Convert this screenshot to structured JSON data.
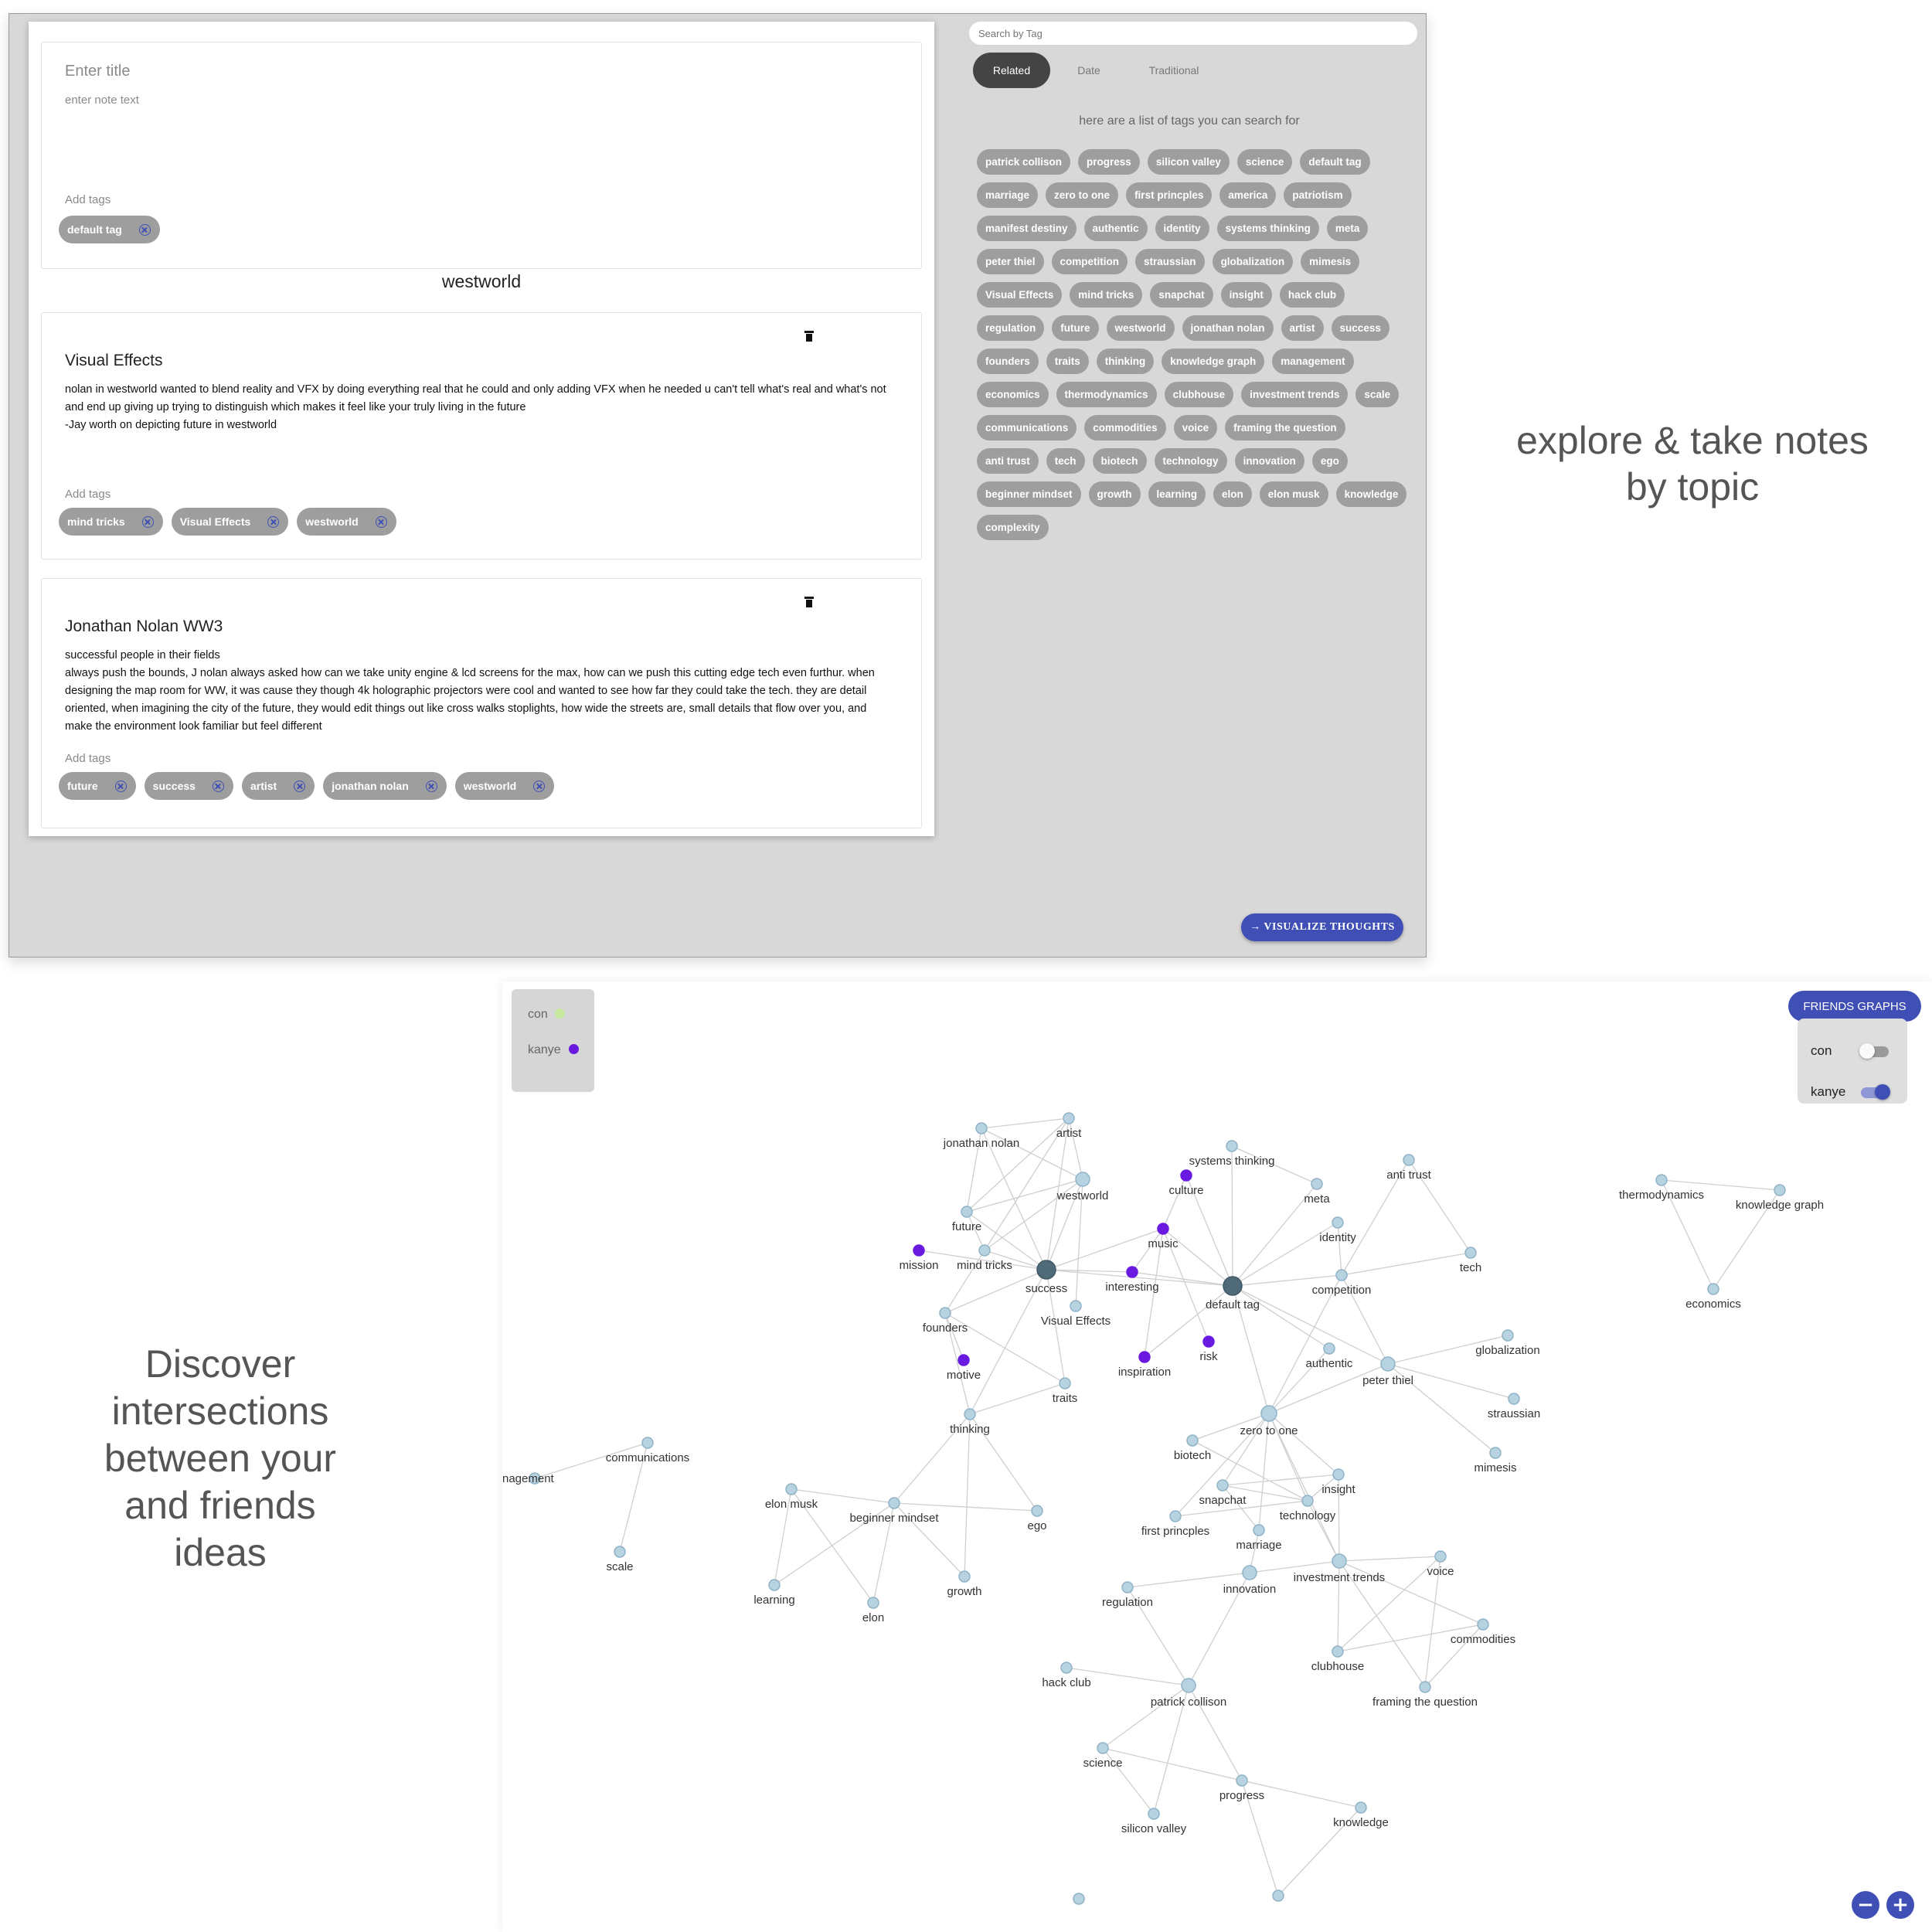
{
  "top": {
    "new_note": {
      "title_placeholder": "Enter title",
      "text_placeholder": "enter note text",
      "add_tags": "Add tags",
      "tags": [
        "default tag"
      ]
    },
    "group_heading": "westworld",
    "notes": [
      {
        "title": "Visual Effects",
        "body": "nolan in westworld wanted to blend reality and VFX by doing everything real that he could and only adding VFX when he needed u can't tell what's real and what's not and end up giving up trying to distinguish which makes it feel like your truly living in the future\n-Jay worth on depicting future in westworld",
        "add_tags": "Add tags",
        "tags": [
          "mind tricks",
          "Visual Effects",
          "westworld"
        ]
      },
      {
        "title": "Jonathan Nolan WW3",
        "body": "successful people in their fields\nalways push the bounds, J nolan always asked how can we take unity engine & lcd screens for the max, how can we push this cutting edge tech even furthur. when designing the map room for WW, it was cause they though 4k holographic projectors were cool and wanted to see how far they could take the tech. they are detail oriented, when imagining the city of the future, they would edit things out like cross walks stoplights, how wide the streets are, small details that flow over you, and make the environment look familiar but feel different",
        "add_tags": "Add tags",
        "tags": [
          "future",
          "success",
          "artist",
          "jonathan nolan",
          "westworld"
        ]
      }
    ],
    "search_placeholder": "Search by Tag",
    "tabs": [
      {
        "label": "Related",
        "active": true
      },
      {
        "label": "Date",
        "active": false
      },
      {
        "label": "Traditional",
        "active": false
      }
    ],
    "hint": "here are a list of tags you can search for",
    "tag_cloud": [
      "patrick collison",
      "progress",
      "silicon valley",
      "science",
      "default tag",
      "marriage",
      "zero to one",
      "first princples",
      "america",
      "patriotism",
      "manifest destiny",
      "authentic",
      "identity",
      "systems thinking",
      "meta",
      "peter thiel",
      "competition",
      "straussian",
      "globalization",
      "mimesis",
      "Visual Effects",
      "mind tricks",
      "snapchat",
      "insight",
      "hack club",
      "regulation",
      "future",
      "westworld",
      "jonathan nolan",
      "artist",
      "success",
      "founders",
      "traits",
      "thinking",
      "knowledge graph",
      "management",
      "economics",
      "thermodynamics",
      "clubhouse",
      "investment trends",
      "scale",
      "communications",
      "commodities",
      "voice",
      "framing the question",
      "anti trust",
      "tech",
      "biotech",
      "technology",
      "innovation",
      "ego",
      "beginner mindset",
      "growth",
      "learning",
      "elon",
      "elon musk",
      "knowledge",
      "complexity"
    ],
    "visualize_button": "→ VISUALIZE THOUGHTS"
  },
  "captions": {
    "top": "explore & take notes by topic",
    "bottom": "Discover intersections between your and friends ideas"
  },
  "graph": {
    "legend": [
      {
        "name": "con",
        "color": "#c7e9a0"
      },
      {
        "name": "kanye",
        "color": "#6a1ae0"
      }
    ],
    "friends_button": "FRIENDS GRAPHS",
    "friends": [
      {
        "name": "con",
        "enabled": false
      },
      {
        "name": "kanye",
        "enabled": true
      }
    ],
    "colors": {
      "node": "#b7d2e0",
      "node_stroke": "#8fb3c7",
      "hub": "#4f6b7a",
      "friend": "#6a1ae0",
      "edge": "#cfcfcf",
      "accent": "#3f4fb5"
    },
    "zoom": {
      "minus": "−",
      "plus": "+"
    },
    "nodes": [
      {
        "id": "jonathan nolan",
        "label": "jonathan nolan"
      },
      {
        "id": "artist",
        "label": "artist"
      },
      {
        "id": "westworld",
        "label": "westworld"
      },
      {
        "id": "future",
        "label": "future"
      },
      {
        "id": "mind tricks",
        "label": "mind tricks"
      },
      {
        "id": "success",
        "label": "success",
        "hub": true
      },
      {
        "id": "mission",
        "label": "mission",
        "friend": true
      },
      {
        "id": "founders",
        "label": "founders"
      },
      {
        "id": "Visual Effects",
        "label": "Visual Effects"
      },
      {
        "id": "motive",
        "label": "motive",
        "friend": true
      },
      {
        "id": "traits",
        "label": "traits"
      },
      {
        "id": "thinking",
        "label": "thinking"
      },
      {
        "id": "culture",
        "label": "culture",
        "friend": true
      },
      {
        "id": "systems thinking",
        "label": "systems thinking"
      },
      {
        "id": "music",
        "label": "music",
        "friend": true
      },
      {
        "id": "interesting",
        "label": "interesting",
        "friend": true
      },
      {
        "id": "inspiration",
        "label": "inspiration",
        "friend": true
      },
      {
        "id": "risk",
        "label": "risk",
        "friend": true
      },
      {
        "id": "default tag",
        "label": "default tag",
        "hub": true
      },
      {
        "id": "meta",
        "label": "meta"
      },
      {
        "id": "anti trust",
        "label": "anti trust"
      },
      {
        "id": "identity",
        "label": "identity"
      },
      {
        "id": "tech",
        "label": "tech"
      },
      {
        "id": "competition",
        "label": "competition"
      },
      {
        "id": "authentic",
        "label": "authentic"
      },
      {
        "id": "peter thiel",
        "label": "peter thiel"
      },
      {
        "id": "globalization",
        "label": "globalization"
      },
      {
        "id": "straussian",
        "label": "straussian"
      },
      {
        "id": "mimesis",
        "label": "mimesis"
      },
      {
        "id": "zero to one",
        "label": "zero to one"
      },
      {
        "id": "biotech",
        "label": "biotech"
      },
      {
        "id": "insight",
        "label": "insight"
      },
      {
        "id": "snapchat",
        "label": "snapchat"
      },
      {
        "id": "technology",
        "label": "technology"
      },
      {
        "id": "first princples",
        "label": "first princples"
      },
      {
        "id": "marriage",
        "label": "marriage"
      },
      {
        "id": "innovation",
        "label": "innovation"
      },
      {
        "id": "investment trends",
        "label": "investment trends"
      },
      {
        "id": "voice",
        "label": "voice"
      },
      {
        "id": "commodities",
        "label": "commodities"
      },
      {
        "id": "clubhouse",
        "label": "clubhouse"
      },
      {
        "id": "framing the question",
        "label": "framing the question"
      },
      {
        "id": "regulation",
        "label": "regulation"
      },
      {
        "id": "hack club",
        "label": "hack club"
      },
      {
        "id": "patrick collison",
        "label": "patrick collison"
      },
      {
        "id": "science",
        "label": "science"
      },
      {
        "id": "progress",
        "label": "progress"
      },
      {
        "id": "silicon valley",
        "label": "silicon valley"
      },
      {
        "id": "knowledge",
        "label": "knowledge"
      },
      {
        "id": "elon musk",
        "label": "elon musk"
      },
      {
        "id": "beginner mindset",
        "label": "beginner mindset"
      },
      {
        "id": "ego",
        "label": "ego"
      },
      {
        "id": "learning",
        "label": "learning"
      },
      {
        "id": "elon",
        "label": "elon"
      },
      {
        "id": "growth",
        "label": "growth"
      },
      {
        "id": "communications",
        "label": "communications"
      },
      {
        "id": "management",
        "label": "nagement"
      },
      {
        "id": "scale",
        "label": "scale"
      },
      {
        "id": "thermodynamics",
        "label": "thermodynamics"
      },
      {
        "id": "knowledge graph",
        "label": "knowledge graph"
      },
      {
        "id": "economics",
        "label": "economics"
      },
      {
        "id": "unlabeled-1",
        "label": ""
      },
      {
        "id": "unlabeled-2",
        "label": ""
      }
    ],
    "edges": [
      [
        "jonathan nolan",
        "artist"
      ],
      [
        "jonathan nolan",
        "westworld"
      ],
      [
        "jonathan nolan",
        "success"
      ],
      [
        "jonathan nolan",
        "future"
      ],
      [
        "artist",
        "westworld"
      ],
      [
        "artist",
        "success"
      ],
      [
        "artist",
        "future"
      ],
      [
        "artist",
        "mind tricks"
      ],
      [
        "westworld",
        "future"
      ],
      [
        "westworld",
        "mind tricks"
      ],
      [
        "westworld",
        "Visual Effects"
      ],
      [
        "westworld",
        "success"
      ],
      [
        "future",
        "success"
      ],
      [
        "future",
        "mind tricks"
      ],
      [
        "mind tricks",
        "success"
      ],
      [
        "mind tricks",
        "founders"
      ],
      [
        "success",
        "founders"
      ],
      [
        "success",
        "traits"
      ],
      [
        "success",
        "thinking"
      ],
      [
        "success",
        "default tag"
      ],
      [
        "success",
        "mission"
      ],
      [
        "success",
        "interesting"
      ],
      [
        "success",
        "music"
      ],
      [
        "founders",
        "traits"
      ],
      [
        "founders",
        "thinking"
      ],
      [
        "founders",
        "motive"
      ],
      [
        "traits",
        "thinking"
      ],
      [
        "thinking",
        "beginner mindset"
      ],
      [
        "thinking",
        "growth"
      ],
      [
        "thinking",
        "ego"
      ],
      [
        "culture",
        "music"
      ],
      [
        "music",
        "interesting"
      ],
      [
        "music",
        "inspiration"
      ],
      [
        "music",
        "risk"
      ],
      [
        "music",
        "default tag"
      ],
      [
        "culture",
        "default tag"
      ],
      [
        "default tag",
        "systems thinking"
      ],
      [
        "default tag",
        "meta"
      ],
      [
        "default tag",
        "identity"
      ],
      [
        "default tag",
        "competition"
      ],
      [
        "default tag",
        "authentic"
      ],
      [
        "default tag",
        "peter thiel"
      ],
      [
        "default tag",
        "zero to one"
      ],
      [
        "default tag",
        "inspiration"
      ],
      [
        "default tag",
        "interesting"
      ],
      [
        "systems thinking",
        "meta"
      ],
      [
        "anti trust",
        "competition"
      ],
      [
        "anti trust",
        "tech"
      ],
      [
        "identity",
        "competition"
      ],
      [
        "competition",
        "tech"
      ],
      [
        "competition",
        "peter thiel"
      ],
      [
        "competition",
        "zero to one"
      ],
      [
        "authentic",
        "zero to one"
      ],
      [
        "peter thiel",
        "zero to one"
      ],
      [
        "peter thiel",
        "globalization"
      ],
      [
        "peter thiel",
        "straussian"
      ],
      [
        "peter thiel",
        "mimesis"
      ],
      [
        "zero to one",
        "biotech"
      ],
      [
        "zero to one",
        "insight"
      ],
      [
        "zero to one",
        "snapchat"
      ],
      [
        "zero to one",
        "technology"
      ],
      [
        "zero to one",
        "first princples"
      ],
      [
        "zero to one",
        "investment trends"
      ],
      [
        "zero to one",
        "marriage"
      ],
      [
        "biotech",
        "technology"
      ],
      [
        "snapchat",
        "technology"
      ],
      [
        "snapchat",
        "insight"
      ],
      [
        "technology",
        "insight"
      ],
      [
        "technology",
        "investment trends"
      ],
      [
        "first princples",
        "technology"
      ],
      [
        "marriage",
        "snapchat"
      ],
      [
        "marriage",
        "innovation"
      ],
      [
        "insight",
        "investment trends"
      ],
      [
        "innovation",
        "regulation"
      ],
      [
        "innovation",
        "patrick collison"
      ],
      [
        "innovation",
        "investment trends"
      ],
      [
        "investment trends",
        "voice"
      ],
      [
        "investment trends",
        "commodities"
      ],
      [
        "investment trends",
        "clubhouse"
      ],
      [
        "investment trends",
        "framing the question"
      ],
      [
        "clubhouse",
        "voice"
      ],
      [
        "clubhouse",
        "commodities"
      ],
      [
        "voice",
        "framing the question"
      ],
      [
        "commodities",
        "framing the question"
      ],
      [
        "regulation",
        "patrick collison"
      ],
      [
        "hack club",
        "patrick collison"
      ],
      [
        "patrick collison",
        "science"
      ],
      [
        "patrick collison",
        "progress"
      ],
      [
        "patrick collison",
        "silicon valley"
      ],
      [
        "science",
        "progress"
      ],
      [
        "science",
        "silicon valley"
      ],
      [
        "progress",
        "knowledge"
      ],
      [
        "progress",
        "unlabeled-2"
      ],
      [
        "knowledge",
        "unlabeled-2"
      ],
      [
        "elon musk",
        "beginner mindset"
      ],
      [
        "elon musk",
        "learning"
      ],
      [
        "elon musk",
        "elon"
      ],
      [
        "beginner mindset",
        "learning"
      ],
      [
        "beginner mindset",
        "elon"
      ],
      [
        "beginner mindset",
        "ego"
      ],
      [
        "beginner mindset",
        "growth"
      ],
      [
        "communications",
        "management"
      ],
      [
        "communications",
        "scale"
      ],
      [
        "thermodynamics",
        "knowledge graph"
      ],
      [
        "thermodynamics",
        "economics"
      ],
      [
        "knowledge graph",
        "economics"
      ]
    ],
    "thick_edge": [
      "zero to one",
      "innovation"
    ]
  }
}
